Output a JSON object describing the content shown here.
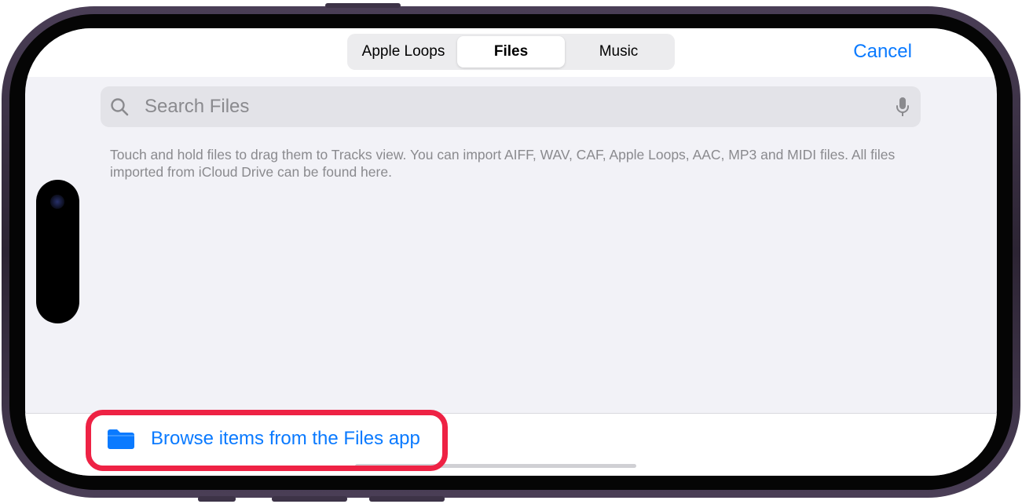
{
  "top_bar": {
    "tabs": [
      {
        "label": "Apple Loops",
        "selected": false
      },
      {
        "label": "Files",
        "selected": true
      },
      {
        "label": "Music",
        "selected": false
      }
    ],
    "cancel_label": "Cancel"
  },
  "search": {
    "placeholder": "Search Files",
    "icon": "search-icon",
    "mic_icon": "microphone-icon"
  },
  "info_text": "Touch and hold files to drag them to Tracks view. You can import AIFF, WAV, CAF, Apple Loops, AAC, MP3 and MIDI files. All files imported from iCloud Drive can be found here.",
  "bottom_bar": {
    "browse_label": "Browse items from the Files app",
    "icon": "folder-icon"
  },
  "colors": {
    "accent": "#0a7aff",
    "highlight": "#ee2244",
    "background": "#f2f2f7",
    "secondary_text": "#8a8a8e"
  }
}
